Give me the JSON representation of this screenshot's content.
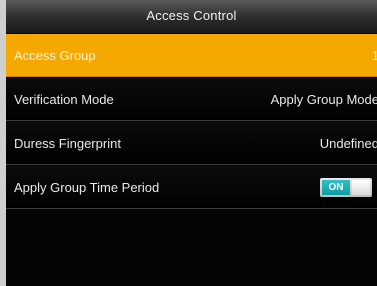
{
  "header": {
    "title": "Access Control"
  },
  "menu": {
    "items": [
      {
        "label": "Access Group",
        "value": "1"
      },
      {
        "label": "Verification Mode",
        "value": "Apply Group Mode"
      },
      {
        "label": "Duress Fingerprint",
        "value": "Undefined"
      },
      {
        "label": "Apply Group Time Period",
        "toggle_text": "ON"
      }
    ]
  },
  "colors": {
    "selection": "#f5a800",
    "toggle_on": "#16a8ae"
  }
}
